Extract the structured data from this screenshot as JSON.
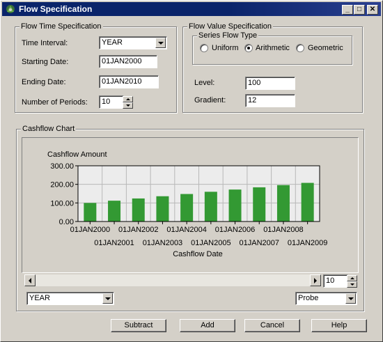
{
  "window": {
    "title": "Flow Specification",
    "icon": "sas-app-icon"
  },
  "titlebar_buttons": {
    "minimize": "_",
    "maximize": "□",
    "close": "✕"
  },
  "time_spec": {
    "title": "Flow Time Specification",
    "interval_label": "Time Interval:",
    "interval_value": "YEAR",
    "start_label": "Starting Date:",
    "start_value": "01JAN2000",
    "end_label": "Ending Date:",
    "end_value": "01JAN2010",
    "periods_label": "Number of Periods:",
    "periods_value": "10"
  },
  "value_spec": {
    "title": "Flow Value Specification",
    "series_title": "Series Flow Type",
    "options": [
      "Uniform",
      "Arithmetic",
      "Geometric"
    ],
    "selected": "Arithmetic",
    "level_label": "Level:",
    "level_value": "100",
    "gradient_label": "Gradient:",
    "gradient_value": "12"
  },
  "cashflow": {
    "title": "Cashflow Chart",
    "periods_value": "10",
    "interval_select": "YEAR",
    "mode_select": "Probe"
  },
  "buttons": {
    "subtract": "Subtract",
    "add": "Add",
    "cancel": "Cancel",
    "help": "Help"
  },
  "colors": {
    "bar": "#339933",
    "titlebar": "#0a246a",
    "face": "#d4d0c8"
  },
  "chart_data": {
    "type": "bar",
    "ylabel": "Cashflow Amount",
    "xlabel": "Cashflow Date",
    "categories": [
      "01JAN2000",
      "01JAN2001",
      "01JAN2002",
      "01JAN2003",
      "01JAN2004",
      "01JAN2005",
      "01JAN2006",
      "01JAN2007",
      "01JAN2008",
      "01JAN2009"
    ],
    "values": [
      100,
      112,
      124,
      136,
      148,
      160,
      172,
      184,
      196,
      208
    ],
    "ylim": [
      0,
      300
    ],
    "yticks": [
      0,
      100,
      200,
      300
    ],
    "ytick_labels": [
      "0.00",
      "100.00",
      "200.00",
      "300.00"
    ],
    "grid": true
  }
}
